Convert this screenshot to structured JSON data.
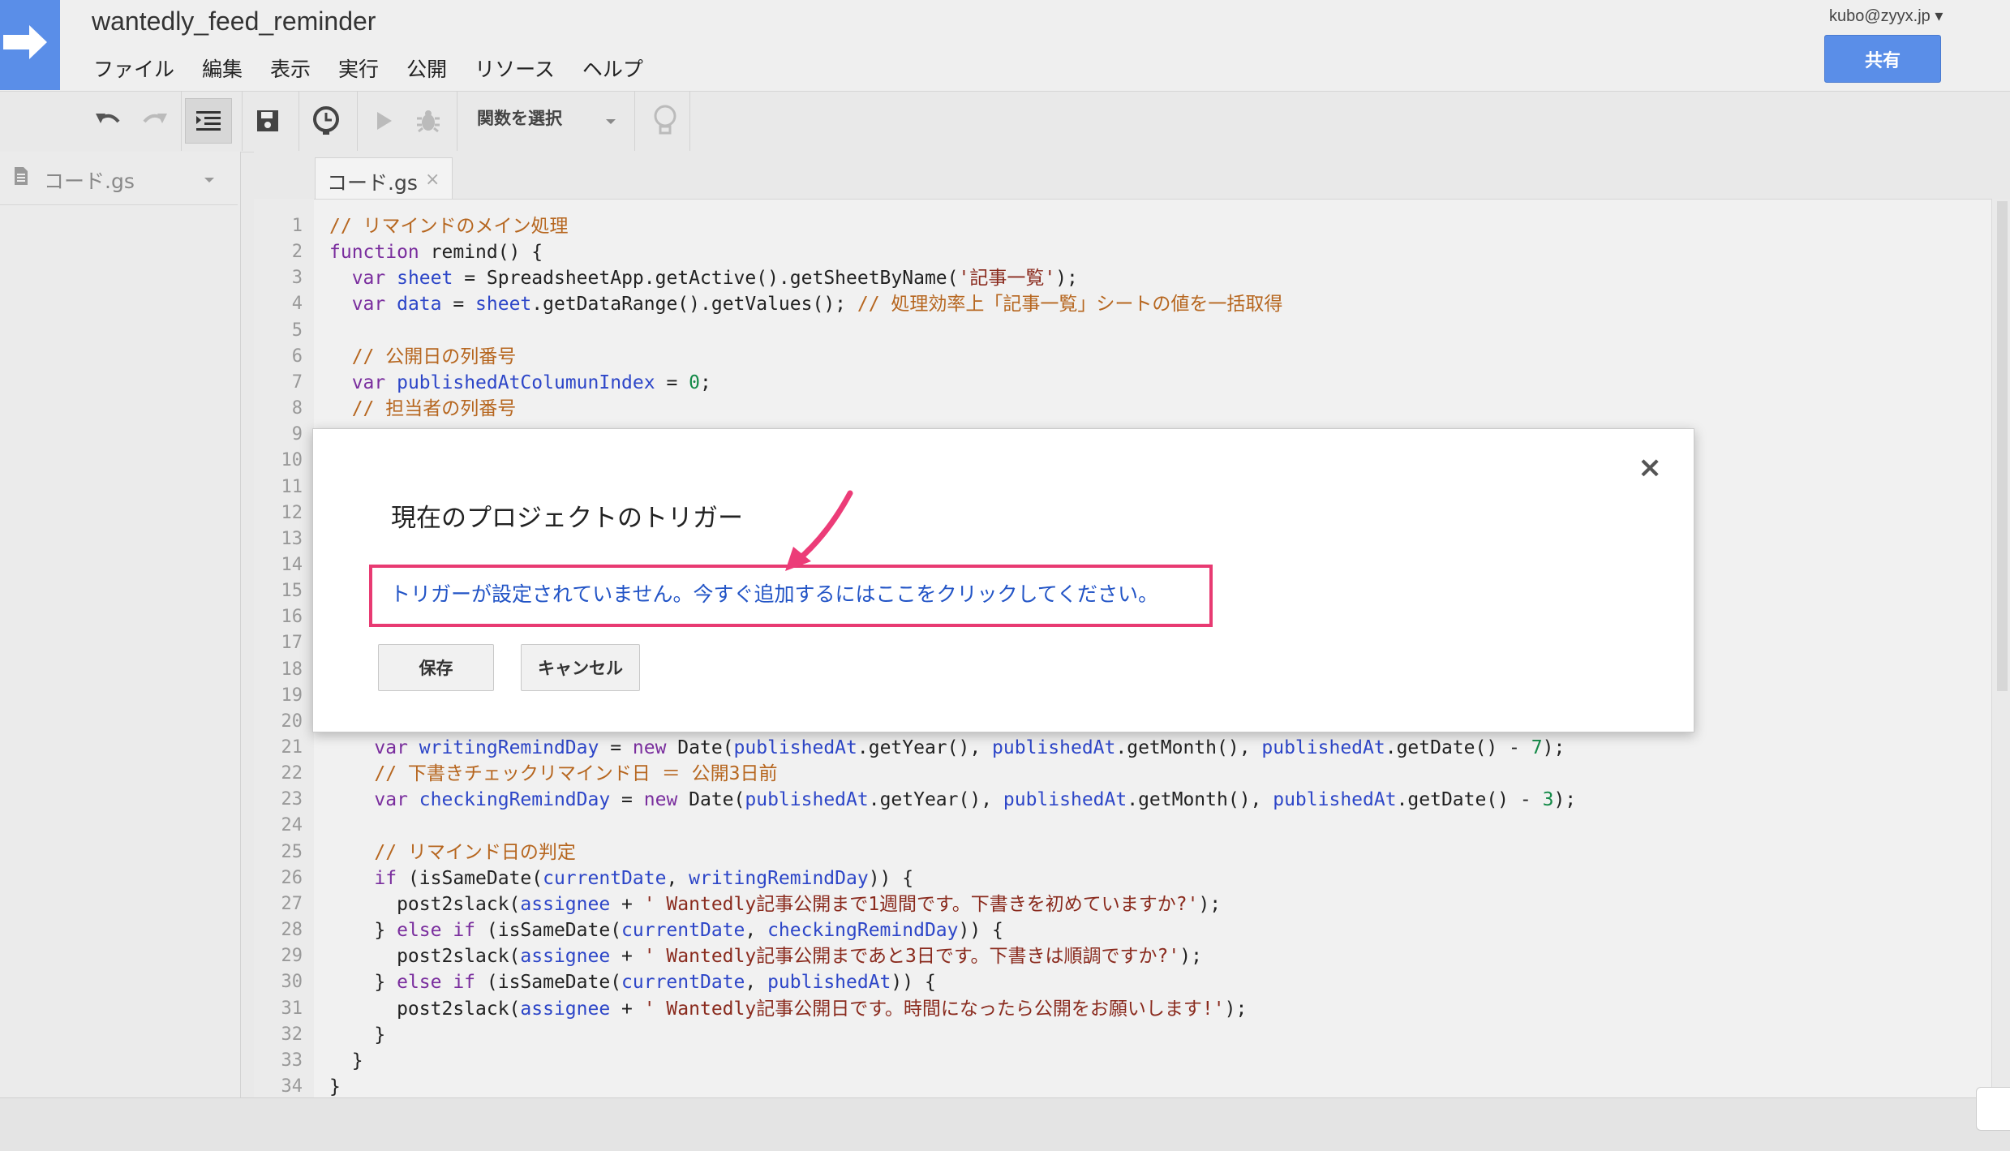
{
  "project": {
    "title": "wantedly_feed_reminder"
  },
  "menu": [
    "ファイル",
    "編集",
    "表示",
    "実行",
    "公開",
    "リソース",
    "ヘルプ"
  ],
  "account": {
    "email": "kubo@zyyx.jp ▾",
    "share_label": "共有"
  },
  "toolbar": {
    "function_select": "関数を選択",
    "icons": [
      "undo-icon",
      "redo-icon",
      "indent-icon",
      "save-icon",
      "triggers-clock-icon",
      "run-icon",
      "debug-bug-icon",
      "lightbulb-icon"
    ]
  },
  "sidebar": {
    "file": "コード.gs"
  },
  "tab": {
    "label": "コード.gs",
    "close": "×"
  },
  "code_lines": [
    {
      "n": "1",
      "html": "<span class='c-com'>// リマインドのメイン処理</span>"
    },
    {
      "n": "2",
      "html": "<span class='c-kw'>function</span> remind() {"
    },
    {
      "n": "3",
      "html": "  <span class='c-kw'>var</span> <span class='c-var'>sheet</span> = SpreadsheetApp.getActive().getSheetByName(<span class='c-str'>'記事一覧'</span>);"
    },
    {
      "n": "4",
      "html": "  <span class='c-kw'>var</span> <span class='c-var'>data</span> = <span class='c-var'>sheet</span>.getDataRange().getValues(); <span class='c-com'>// 処理効率上「記事一覧」シートの値を一括取得</span>"
    },
    {
      "n": "5",
      "html": ""
    },
    {
      "n": "6",
      "html": "  <span class='c-com'>// 公開日の列番号</span>"
    },
    {
      "n": "7",
      "html": "  <span class='c-kw'>var</span> <span class='c-var'>publishedAtColumunIndex</span> = <span class='c-num'>0</span>;"
    },
    {
      "n": "8",
      "html": "  <span class='c-com'>// 担当者の列番号</span>"
    },
    {
      "n": "9",
      "html": ""
    },
    {
      "n": "10",
      "html": ""
    },
    {
      "n": "11",
      "html": ""
    },
    {
      "n": "12",
      "html": ""
    },
    {
      "n": "13",
      "html": ""
    },
    {
      "n": "14",
      "html": ""
    },
    {
      "n": "15",
      "html": ""
    },
    {
      "n": "16",
      "html": ""
    },
    {
      "n": "17",
      "html": ""
    },
    {
      "n": "18",
      "html": ""
    },
    {
      "n": "19",
      "html": ""
    },
    {
      "n": "20",
      "html": ""
    },
    {
      "n": "21",
      "html": "    <span class='c-kw'>var</span> <span class='c-var'>writingRemindDay</span> = <span class='c-kw'>new</span> Date(<span class='c-var'>publishedAt</span>.getYear(), <span class='c-var'>publishedAt</span>.getMonth(), <span class='c-var'>publishedAt</span>.getDate() - <span class='c-num'>7</span>);"
    },
    {
      "n": "22",
      "html": "    <span class='c-com'>// 下書きチェックリマインド日 ＝ 公開3日前</span>"
    },
    {
      "n": "23",
      "html": "    <span class='c-kw'>var</span> <span class='c-var'>checkingRemindDay</span> = <span class='c-kw'>new</span> Date(<span class='c-var'>publishedAt</span>.getYear(), <span class='c-var'>publishedAt</span>.getMonth(), <span class='c-var'>publishedAt</span>.getDate() - <span class='c-num'>3</span>);"
    },
    {
      "n": "24",
      "html": ""
    },
    {
      "n": "25",
      "html": "    <span class='c-com'>// リマインド日の判定</span>"
    },
    {
      "n": "26",
      "html": "    <span class='c-kw'>if</span> (isSameDate(<span class='c-var'>currentDate</span>, <span class='c-var'>writingRemindDay</span>)) {"
    },
    {
      "n": "27",
      "html": "      post2slack(<span class='c-var'>assignee</span> + <span class='c-str'>' Wantedly記事公開まで1週間です。下書きを初めていますか?'</span>);"
    },
    {
      "n": "28",
      "html": "    } <span class='c-kw'>else if</span> (isSameDate(<span class='c-var'>currentDate</span>, <span class='c-var'>checkingRemindDay</span>)) {"
    },
    {
      "n": "29",
      "html": "      post2slack(<span class='c-var'>assignee</span> + <span class='c-str'>' Wantedly記事公開まであと3日です。下書きは順調ですか?'</span>);"
    },
    {
      "n": "30",
      "html": "    } <span class='c-kw'>else if</span> (isSameDate(<span class='c-var'>currentDate</span>, <span class='c-var'>publishedAt</span>)) {"
    },
    {
      "n": "31",
      "html": "      post2slack(<span class='c-var'>assignee</span> + <span class='c-str'>' Wantedly記事公開日です。時間になったら公開をお願いします!'</span>);"
    },
    {
      "n": "32",
      "html": "    }"
    },
    {
      "n": "33",
      "html": "  }"
    },
    {
      "n": "34",
      "html": "}"
    }
  ],
  "dialog": {
    "title": "現在のプロジェクトのトリガー",
    "link": "トリガーが設定されていません。今すぐ追加するにはここをクリックしてください。",
    "save": "保存",
    "cancel": "キャンセル",
    "close": "×"
  },
  "colors": {
    "accent": "#5a8ee8",
    "highlight": "#e83a72",
    "link": "#2254c6"
  }
}
